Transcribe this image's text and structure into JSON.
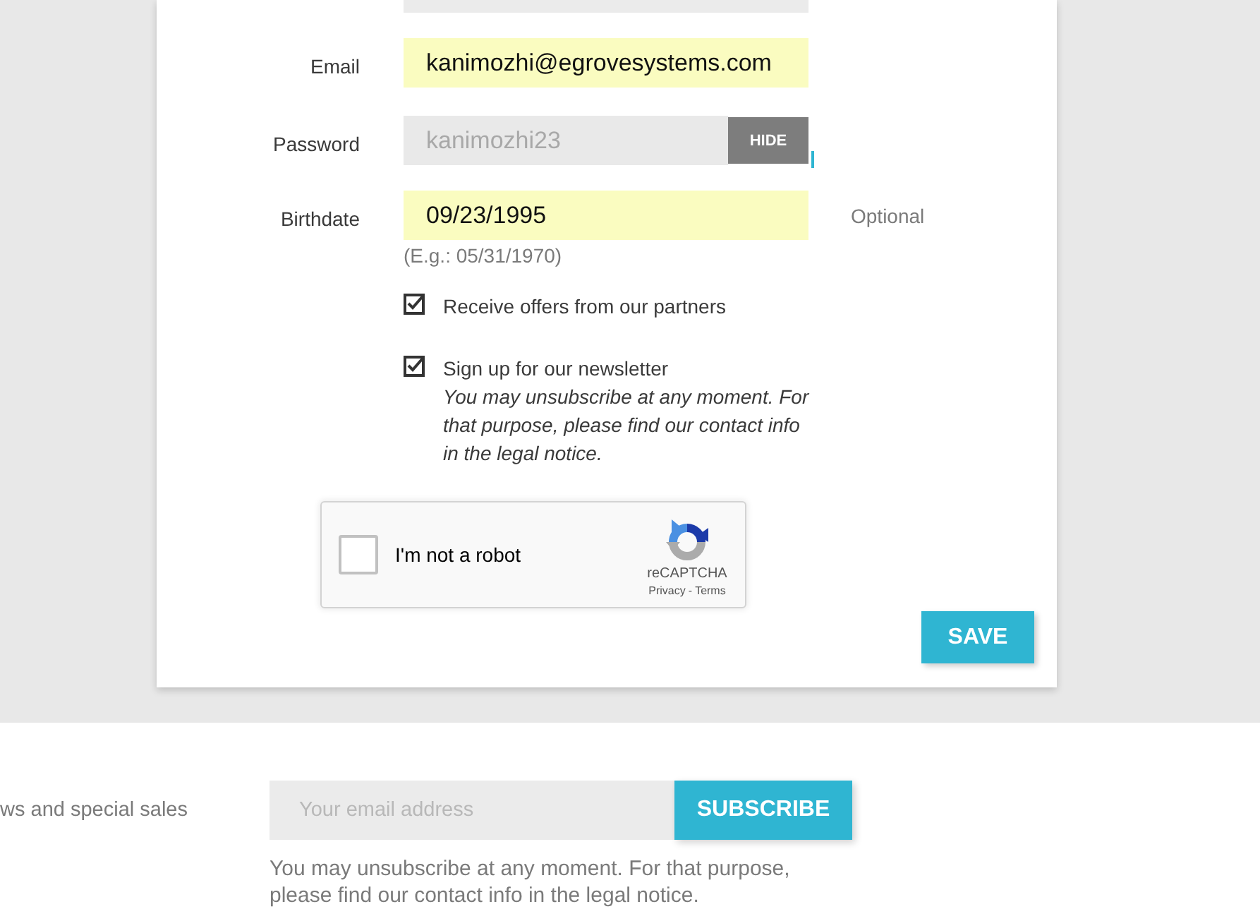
{
  "form": {
    "fields": [
      {
        "kind": "text",
        "label": "Email",
        "value": "kanimozhi@egrovesystems.com",
        "autofilled": true
      },
      {
        "kind": "password",
        "label": "Password",
        "value": "kanimozhi23",
        "autofilled": false,
        "toggle": "HIDE"
      },
      {
        "kind": "text",
        "label": "Birthdate",
        "value": "09/23/1995",
        "autofilled": true,
        "note": "Optional",
        "hint": "(E.g.: 05/31/1970)"
      }
    ],
    "checkboxes": [
      {
        "label": "Receive offers from our partners",
        "checked": true
      },
      {
        "label": "Sign up for our newsletter",
        "checked": true,
        "description": "You may unsubscribe at any moment. For that purpose, please find our contact info in the legal notice."
      }
    ],
    "captcha": {
      "label": "I'm not a robot",
      "checked": false,
      "brand": "reCAPTCHA",
      "privacy_link": "Privacy",
      "separator": "-",
      "terms_link": "Terms"
    },
    "save_button": "SAVE"
  },
  "newsletter": {
    "text": "ws and special sales",
    "placeholder": "Your email address",
    "button": "SUBSCRIBE",
    "note": "You may unsubscribe at any moment. For that purpose, please find our contact info in the legal notice."
  }
}
